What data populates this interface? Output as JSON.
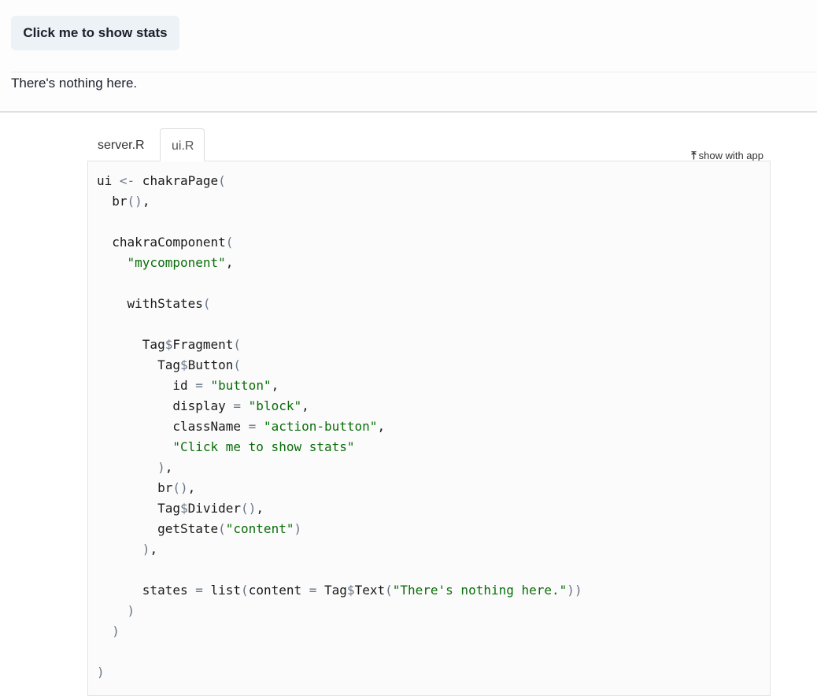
{
  "app": {
    "button_label": "Click me to show stats",
    "content_text": "There's nothing here."
  },
  "code_panel": {
    "tabs": [
      "server.R",
      "ui.R"
    ],
    "active_tab": "ui.R",
    "show_with_app_icon": "arrow-up-icon",
    "show_with_app_label": "show with app",
    "code_lines": [
      "ui <- chakraPage(",
      "  br(),",
      "",
      "  chakraComponent(",
      "    \"mycomponent\",",
      "",
      "    withStates(",
      "",
      "      Tag$Fragment(",
      "        Tag$Button(",
      "          id = \"button\",",
      "          display = \"block\",",
      "          className = \"action-button\",",
      "          \"Click me to show stats\"",
      "        ),",
      "        br(),",
      "        Tag$Divider(),",
      "        getState(\"content\")",
      "      ),",
      "",
      "      states = list(content = Tag$Text(\"There's nothing here.\"))",
      "    )",
      "  )",
      "",
      ")"
    ]
  },
  "colors": {
    "button_bg": "#edf2f7",
    "string": "#0a6e0a",
    "operator": "#687687",
    "code_bg": "#fbfbfb"
  }
}
